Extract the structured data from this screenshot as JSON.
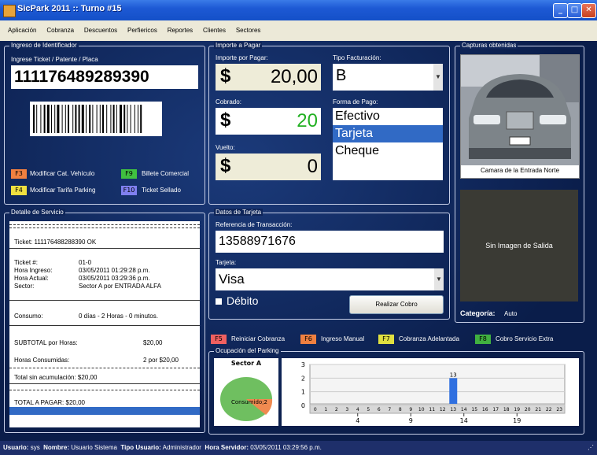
{
  "window": {
    "title": "SicPark 2011 :: Turno #15"
  },
  "menu": [
    "Aplicación",
    "Cobranza",
    "Descuentos",
    "Perfiericos",
    "Reportes",
    "Clientes",
    "Sectores"
  ],
  "identificador": {
    "group_label": "Ingreso de Identificador",
    "field_label": "Ingrese Ticket / Patente / Placa",
    "value": "111176489289390",
    "shortcuts": [
      {
        "key": "F3",
        "label": "Modificar Cat. Vehículo",
        "color": "#f08040"
      },
      {
        "key": "F9",
        "label": "Billete Comercial",
        "color": "#40c040"
      },
      {
        "key": "F4",
        "label": "Modificar Tarifa Parking",
        "color": "#f0e040"
      },
      {
        "key": "F10",
        "label": "Ticket Sellado",
        "color": "#8080f0"
      }
    ]
  },
  "importe": {
    "group_label": "Importe a Pagar",
    "importe_label": "Importe por Pagar:",
    "importe_symbol": "$",
    "importe_value": "20,00",
    "cobrado_label": "Cobrado:",
    "cobrado_symbol": "$",
    "cobrado_value": "20",
    "vuelto_label": "Vuelto:",
    "vuelto_symbol": "$",
    "vuelto_value": "0",
    "tipo_label": "Tipo Facturación:",
    "tipo_value": "B",
    "forma_label": "Forma de Pago:",
    "formas": [
      "Efectivo",
      "Tarjeta",
      "Cheque"
    ],
    "forma_selected": "Tarjeta"
  },
  "capturas": {
    "group_label": "Capturas obtenidas",
    "entrada_caption": "Camara de la Entrada Norte",
    "plate_text": "BIS 886",
    "salida_text": "Sin Imagen de Salida",
    "categoria_label": "Categoría:",
    "categoria_value": "Auto"
  },
  "detalle": {
    "group_label": "Detalle de Servicio",
    "ticket_line": "Ticket: 111176488288390 OK",
    "fields": [
      {
        "k": "Ticket #:",
        "v": "01-0"
      },
      {
        "k": "Hora Ingreso:",
        "v": "03/05/2011 01:29:28 p.m."
      },
      {
        "k": "Hora Actual:",
        "v": "03/05/2011 03:29:36 p.m."
      },
      {
        "k": "Sector:",
        "v": "Sector A por ENTRADA ALFA"
      }
    ],
    "consumo_k": "Consumo:",
    "consumo_v": "0 días - 2 Horas - 0 minutos.",
    "subtotal_k": "SUBTOTAL por Horas:",
    "subtotal_v": "$20,00",
    "horas_k": "Horas Consumidas:",
    "horas_v": "2 por $20,00",
    "total_sin": "Total sin acumulación: $20,00",
    "total_pagar": "TOTAL A PAGAR: $20,00"
  },
  "tarjeta": {
    "group_label": "Datos de Tarjeta",
    "ref_label": "Referencia de Transacción:",
    "ref_value": "13588971676",
    "tarjeta_label": "Tarjeta:",
    "tarjeta_value": "Visa",
    "debito_label": "Débito",
    "realizar_button": "Realizar Cobro"
  },
  "fkeys": [
    {
      "key": "F5",
      "label": "Reiniciar Cobranza",
      "color": "#f06060"
    },
    {
      "key": "F6",
      "label": "Ingreso Manual",
      "color": "#f08040"
    },
    {
      "key": "F7",
      "label": "Cobranza Adelantada",
      "color": "#e0e040"
    },
    {
      "key": "F8",
      "label": "Cobro Servicio Extra",
      "color": "#40b040"
    }
  ],
  "ocupacion": {
    "group_label": "Ocupación del Parking",
    "pie_title": "Sector A",
    "pie_label": "Consumido;2"
  },
  "chart_data": {
    "type": "bar",
    "categories": [
      "0",
      "1",
      "2",
      "3",
      "4",
      "5",
      "6",
      "7",
      "8",
      "9",
      "10",
      "11",
      "12",
      "13",
      "14",
      "15",
      "16",
      "17",
      "18",
      "19",
      "20",
      "21",
      "22",
      "23"
    ],
    "values": [
      0,
      0,
      0,
      0,
      0,
      0,
      0,
      0,
      0,
      0,
      0,
      0,
      0,
      2,
      0,
      0,
      0,
      0,
      0,
      0,
      0,
      0,
      0,
      0
    ],
    "highlight_label": "13",
    "ylim": [
      0,
      3
    ],
    "yticks": [
      "0",
      "1",
      "2",
      "3"
    ],
    "xticks_bottom": [
      "4",
      "9",
      "14",
      "19"
    ],
    "bar_color": "#3070e0"
  },
  "status": {
    "usuario_k": "Usuario:",
    "usuario_v": "sys",
    "nombre_k": "Nombre:",
    "nombre_v": "Usuario Sistema",
    "tipo_k": "Tipo Usuario:",
    "tipo_v": "Administrador",
    "hora_k": "Hora Servidor:",
    "hora_v": "03/05/2011 03:29:56 p.m."
  }
}
